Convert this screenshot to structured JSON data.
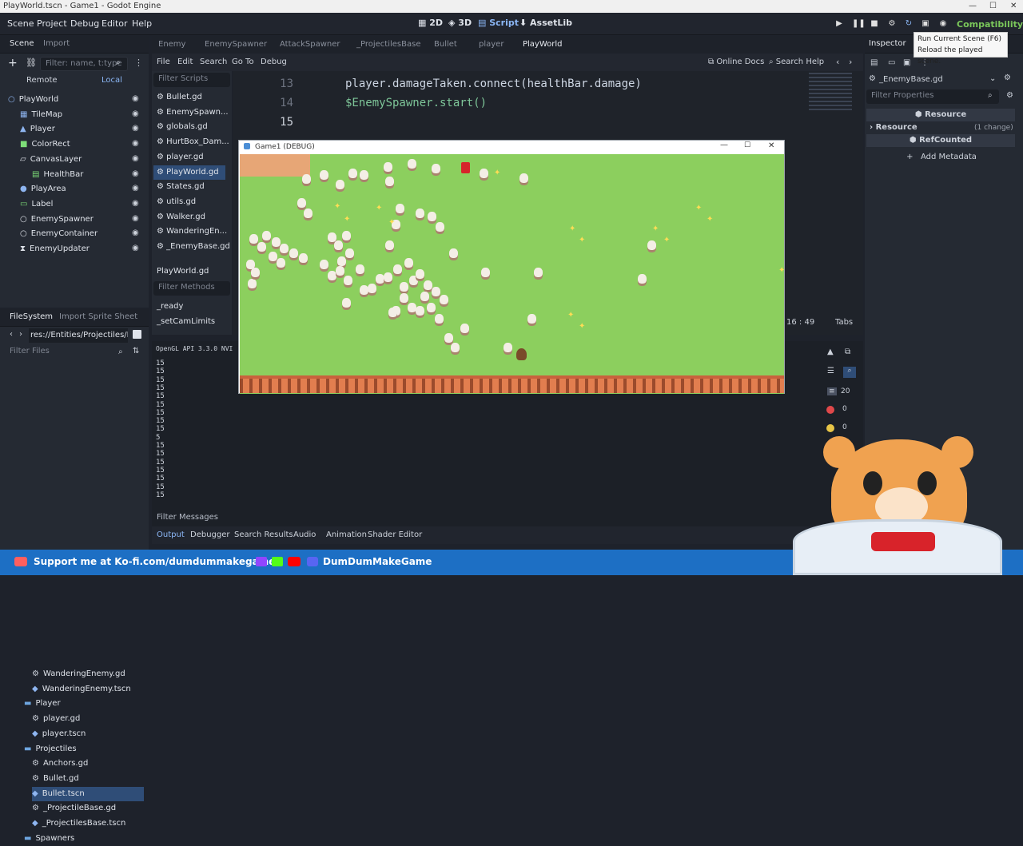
{
  "window": {
    "title": "PlayWorld.tscn - Game1 - Godot Engine",
    "minimize": "—",
    "maximize": "☐",
    "close": "✕"
  },
  "menu": [
    "Scene",
    "Project",
    "Debug",
    "Editor",
    "Help"
  ],
  "workspaces": {
    "2d": "2D",
    "3d": "3D",
    "script": "Script",
    "assetlib": "AssetLib"
  },
  "renderer": "Compatibility",
  "tooltip": {
    "line1": "Run Current Scene (F6)",
    "line2": "Reload the played scene."
  },
  "scene_dock": {
    "tabs": [
      "Scene",
      "Import"
    ],
    "filter_placeholder": "Filter: name, t:type",
    "remote": "Remote",
    "local": "Local",
    "tree": [
      {
        "label": "PlayWorld",
        "icon": "node2d-icon",
        "color": "#8eb5f0"
      },
      {
        "label": "TileMap",
        "icon": "tilemap-icon",
        "color": "#8eb5f0"
      },
      {
        "label": "Player",
        "icon": "character-icon",
        "color": "#8eb5f0"
      },
      {
        "label": "ColorRect",
        "icon": "colorrect-icon",
        "color": "#7dde78"
      },
      {
        "label": "CanvasLayer",
        "icon": "canvaslayer-icon",
        "color": "#dfe3ea"
      },
      {
        "label": "HealthBar",
        "icon": "progressbar-icon",
        "color": "#7dde78"
      },
      {
        "label": "PlayArea",
        "icon": "area-icon",
        "color": "#8eb5f0"
      },
      {
        "label": "Label",
        "icon": "label-icon",
        "color": "#7dde78"
      },
      {
        "label": "EnemySpawner",
        "icon": "node-icon",
        "color": "#dfe3ea"
      },
      {
        "label": "EnemyContainer",
        "icon": "node-icon",
        "color": "#dfe3ea"
      },
      {
        "label": "EnemyUpdater",
        "icon": "timer-icon",
        "color": "#dfe3ea"
      }
    ]
  },
  "filesystem": {
    "tabs": [
      "FileSystem",
      "Import Sprite Sheet"
    ],
    "path": "res://Entities/Projectiles/Bu",
    "filter_placeholder": "Filter Files",
    "items": [
      {
        "label": "WanderingEnemy.gd",
        "type": "script"
      },
      {
        "label": "WanderingEnemy.tscn",
        "type": "scene"
      },
      {
        "label": "Player",
        "type": "folder"
      },
      {
        "label": "player.gd",
        "type": "script"
      },
      {
        "label": "player.tscn",
        "type": "scene"
      },
      {
        "label": "Projectiles",
        "type": "folder"
      },
      {
        "label": "Anchors.gd",
        "type": "script"
      },
      {
        "label": "Bullet.gd",
        "type": "script"
      },
      {
        "label": "Bullet.tscn",
        "type": "scene"
      },
      {
        "label": "_ProjectileBase.gd",
        "type": "script"
      },
      {
        "label": "_ProjectilesBase.tscn",
        "type": "scene"
      },
      {
        "label": "Spawners",
        "type": "folder"
      }
    ]
  },
  "editor_tabs": [
    "Enemy",
    "EnemySpawner",
    "AttackSpawner",
    "_ProjectilesBase",
    "Bullet",
    "player",
    "PlayWorld"
  ],
  "script_menu": [
    "File",
    "Edit",
    "Search",
    "Go To",
    "Debug"
  ],
  "online_docs": "Online Docs",
  "search_help": "Search Help",
  "scripts_filter": "Filter Scripts",
  "scripts": [
    "Bullet.gd",
    "EnemySpawn...",
    "globals.gd",
    "HurtBox_Dam...",
    "player.gd",
    "PlayWorld.gd",
    "States.gd",
    "utils.gd",
    "Walker.gd",
    "WanderingEn...",
    "_EnemyBase.gd"
  ],
  "current_script": "PlayWorld.gd",
  "methods_filter": "Filter Methods",
  "methods": [
    "_ready",
    "_setCamLimits"
  ],
  "code": [
    {
      "n": "13",
      "text": "player.damageTaken.connect(healthBar.damage)"
    },
    {
      "n": "14",
      "text": "$EnemySpawner.start()"
    },
    {
      "n": "15",
      "text": ""
    }
  ],
  "cursor": {
    "pos": "16 :   49",
    "indent": "Tabs"
  },
  "output": {
    "header": "OpenGL API 3.3.0 NVI",
    "lines": [
      "15",
      "15",
      "15",
      "15",
      "15",
      "15",
      "15",
      "15",
      "15",
      "5",
      "15",
      "15",
      "15",
      "15",
      "15",
      "15",
      "15"
    ],
    "filter": "Filter Messages",
    "tabs": [
      "Output",
      "Debugger",
      "Search Results",
      "Audio",
      "Animation",
      "Shader Editor"
    ],
    "counts": {
      "messages": "20",
      "errors": "0",
      "warnings": "0"
    }
  },
  "game_window": {
    "title": "Game1 (DEBUG)"
  },
  "inspector": {
    "tab": "Inspector",
    "resource": "_EnemyBase.gd",
    "filter_placeholder": "Filter Properties",
    "section_resource": "Resource",
    "resource_label": "Resource",
    "resource_changes": "(1 change)",
    "refcounted": "RefCounted",
    "add_metadata": "Add Metadata"
  },
  "banner": {
    "kofi": "Support me at Ko-fi.com/dumdummakegame",
    "channel": "DumDumMakeGame"
  }
}
